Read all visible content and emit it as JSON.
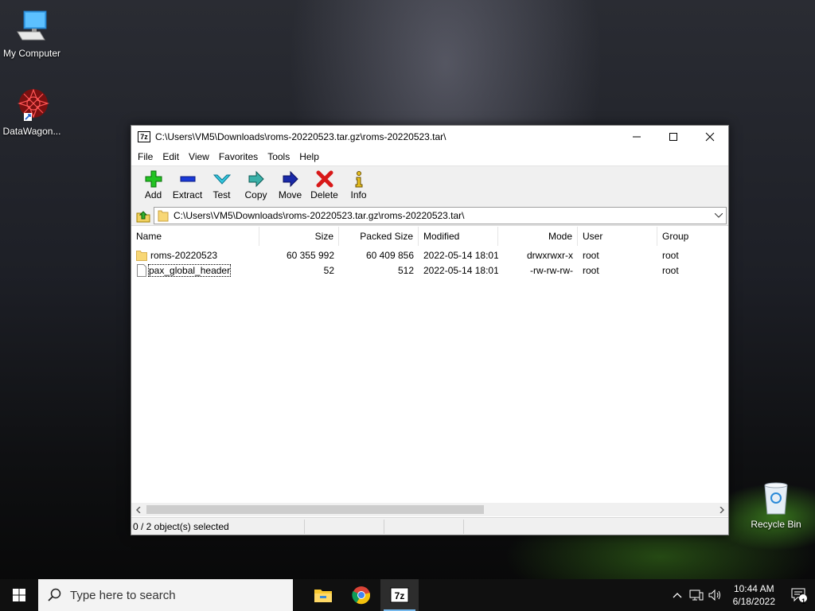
{
  "desktop": {
    "icons": [
      {
        "label": "My Computer"
      },
      {
        "label": "DataWagon..."
      },
      {
        "label": "Recycle Bin"
      }
    ]
  },
  "window": {
    "title": "C:\\Users\\VM5\\Downloads\\roms-20220523.tar.gz\\roms-20220523.tar\\",
    "app_icon_text": "7z",
    "controls": {
      "minimize": "—",
      "maximize": "☐",
      "close": "✕"
    }
  },
  "menu": [
    "File",
    "Edit",
    "View",
    "Favorites",
    "Tools",
    "Help"
  ],
  "toolbar": [
    "Add",
    "Extract",
    "Test",
    "Copy",
    "Move",
    "Delete",
    "Info"
  ],
  "address": {
    "path": "C:\\Users\\VM5\\Downloads\\roms-20220523.tar.gz\\roms-20220523.tar\\"
  },
  "list": {
    "columns": [
      "Name",
      "Size",
      "Packed Size",
      "Modified",
      "Mode",
      "User",
      "Group"
    ],
    "rows": [
      {
        "name": "roms-20220523",
        "type": "folder",
        "size": "60 355 992",
        "packed": "60 409 856",
        "modified": "2022-05-14 18:01",
        "mode": "drwxrwxr-x",
        "user": "root",
        "group": "root"
      },
      {
        "name": "pax_global_header",
        "type": "file",
        "size": "52",
        "packed": "512",
        "modified": "2022-05-14 18:01",
        "mode": "-rw-rw-rw-",
        "user": "root",
        "group": "root"
      }
    ]
  },
  "status": {
    "selected": "0 / 2 object(s) selected"
  },
  "taskbar": {
    "search_placeholder": "Type here to search",
    "time": "10:44 AM",
    "date": "6/18/2022",
    "notification_count": "1"
  },
  "colors": {
    "accent": "#76b9ed",
    "folder": "#f8d775"
  }
}
